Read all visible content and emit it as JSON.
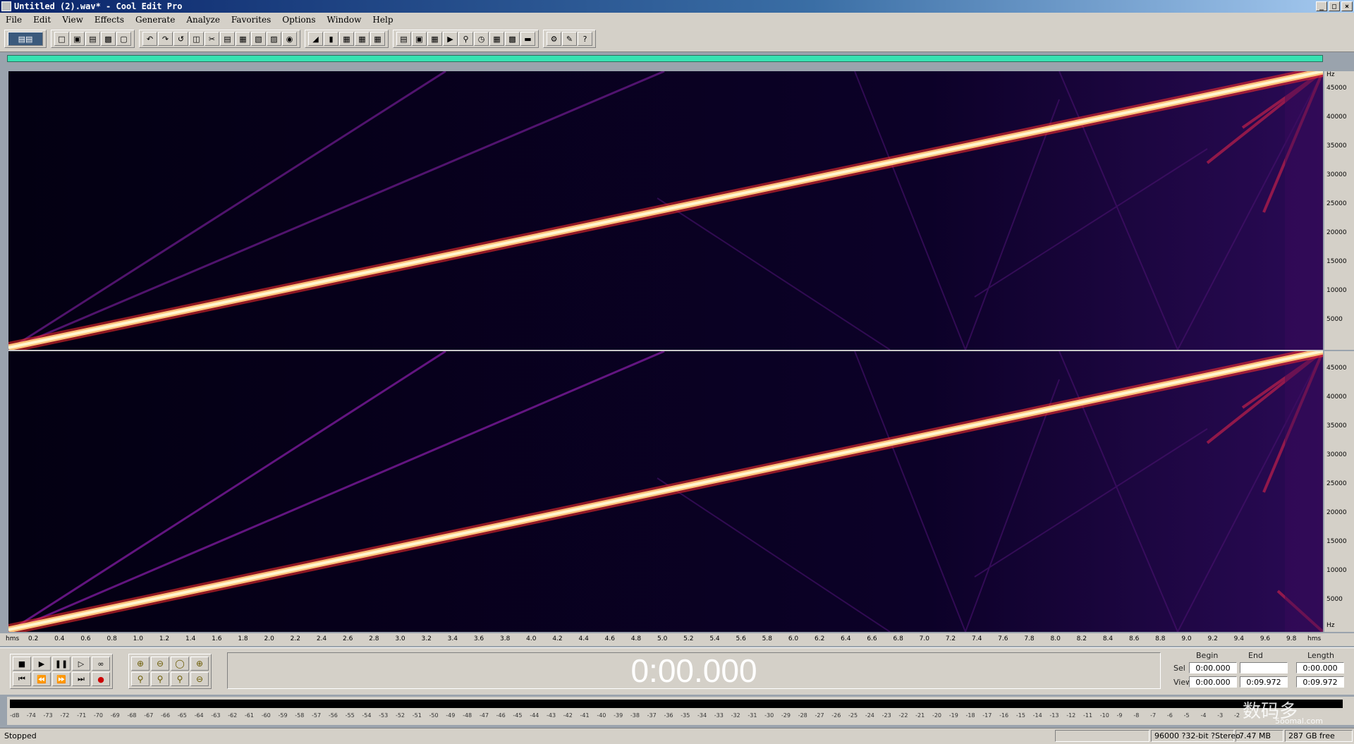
{
  "window": {
    "title": "Untitled (2).wav* - Cool Edit Pro",
    "buttons": [
      "_",
      "□",
      "×"
    ]
  },
  "menu": [
    "File",
    "Edit",
    "View",
    "Effects",
    "Generate",
    "Analyze",
    "Favorites",
    "Options",
    "Window",
    "Help"
  ],
  "toolbar": {
    "mode_button": "multitrack-toggle-icon",
    "groups": [
      [
        "new-icon",
        "open-icon",
        "save-icon",
        "save-all-icon",
        "close-icon"
      ],
      [
        "undo-icon",
        "redo-icon",
        "repeat-icon",
        "copy-icon",
        "cut-icon",
        "paste-icon",
        "paste-new-icon",
        "mix-paste-icon",
        "trim-icon",
        "mute-icon"
      ],
      [
        "waveform-icon",
        "spectral-icon",
        "view-left-icon",
        "view-right-icon",
        "view-both-icon"
      ],
      [
        "info-icon",
        "cue-icon",
        "play-list-icon",
        "play-icon",
        "zoom-icon",
        "time-icon",
        "grid-icon",
        "levels-icon",
        "ruler-icon"
      ],
      [
        "settings-icon",
        "edit-icon",
        "help-icon"
      ]
    ]
  },
  "spectrogram": {
    "freq_unit": "Hz",
    "freq_ticks": [
      "45000",
      "40000",
      "35000",
      "30000",
      "25000",
      "20000",
      "15000",
      "10000",
      "5000"
    ],
    "channels": [
      "left",
      "right"
    ],
    "colors": {
      "background": "#050015",
      "harmonic": "#6a1a8a",
      "sweep_core": "#fff6d0",
      "sweep_glow": "#ff3a3a"
    }
  },
  "time_ruler": {
    "unit": "hms",
    "ticks": [
      "0.2",
      "0.4",
      "0.6",
      "0.8",
      "1.0",
      "1.2",
      "1.4",
      "1.6",
      "1.8",
      "2.0",
      "2.2",
      "2.4",
      "2.6",
      "2.8",
      "3.0",
      "3.2",
      "3.4",
      "3.6",
      "3.8",
      "4.0",
      "4.2",
      "4.4",
      "4.6",
      "4.8",
      "5.0",
      "5.2",
      "5.4",
      "5.6",
      "5.8",
      "6.0",
      "6.2",
      "6.4",
      "6.6",
      "6.8",
      "7.0",
      "7.2",
      "7.4",
      "7.6",
      "7.8",
      "8.0",
      "8.2",
      "8.4",
      "8.6",
      "8.8",
      "9.0",
      "9.2",
      "9.4",
      "9.6",
      "9.8"
    ]
  },
  "transport": {
    "row1": [
      "stop-icon",
      "play-icon",
      "pause-icon",
      "play-to-end-icon",
      "loop-icon"
    ],
    "row2": [
      "go-start-icon",
      "rewind-icon",
      "fast-forward-icon",
      "go-end-icon",
      "record-icon"
    ],
    "zoom_row1": [
      "zoom-in-icon",
      "zoom-out-icon",
      "zoom-full-icon",
      "zoom-in-vertical-icon"
    ],
    "zoom_row2": [
      "zoom-left-icon",
      "zoom-sel-icon",
      "zoom-right-icon",
      "zoom-out-vertical-icon"
    ]
  },
  "time_display": "0:00.000",
  "selection": {
    "headers": {
      "begin": "Begin",
      "end": "End",
      "length": "Length"
    },
    "sel": {
      "label": "Sel",
      "begin": "0:00.000",
      "end": "",
      "length": "0:00.000"
    },
    "view": {
      "label": "View",
      "begin": "0:00.000",
      "end": "0:09.972",
      "length": "0:09.972"
    }
  },
  "level_meter": {
    "labels": [
      "-dB",
      "-74",
      "-73",
      "-72",
      "-71",
      "-70",
      "-69",
      "-68",
      "-67",
      "-66",
      "-65",
      "-64",
      "-63",
      "-62",
      "-61",
      "-60",
      "-59",
      "-58",
      "-57",
      "-56",
      "-55",
      "-54",
      "-53",
      "-52",
      "-51",
      "-50",
      "-49",
      "-48",
      "-47",
      "-46",
      "-45",
      "-44",
      "-43",
      "-42",
      "-41",
      "-40",
      "-39",
      "-38",
      "-37",
      "-36",
      "-35",
      "-34",
      "-33",
      "-32",
      "-31",
      "-30",
      "-29",
      "-28",
      "-27",
      "-26",
      "-25",
      "-24",
      "-23",
      "-22",
      "-21",
      "-20",
      "-19",
      "-18",
      "-17",
      "-16",
      "-15",
      "-14",
      "-13",
      "-12",
      "-11",
      "-10",
      "-9",
      "-8",
      "-7",
      "-6",
      "-5",
      "-4",
      "-3",
      "-2"
    ]
  },
  "status": {
    "state": "Stopped",
    "format": "96000 ?32-bit ?Stereo",
    "size": "7.47 MB",
    "free": "287 GB free"
  },
  "watermark": {
    "main": "数码多",
    "sub": "5oomal.com"
  }
}
